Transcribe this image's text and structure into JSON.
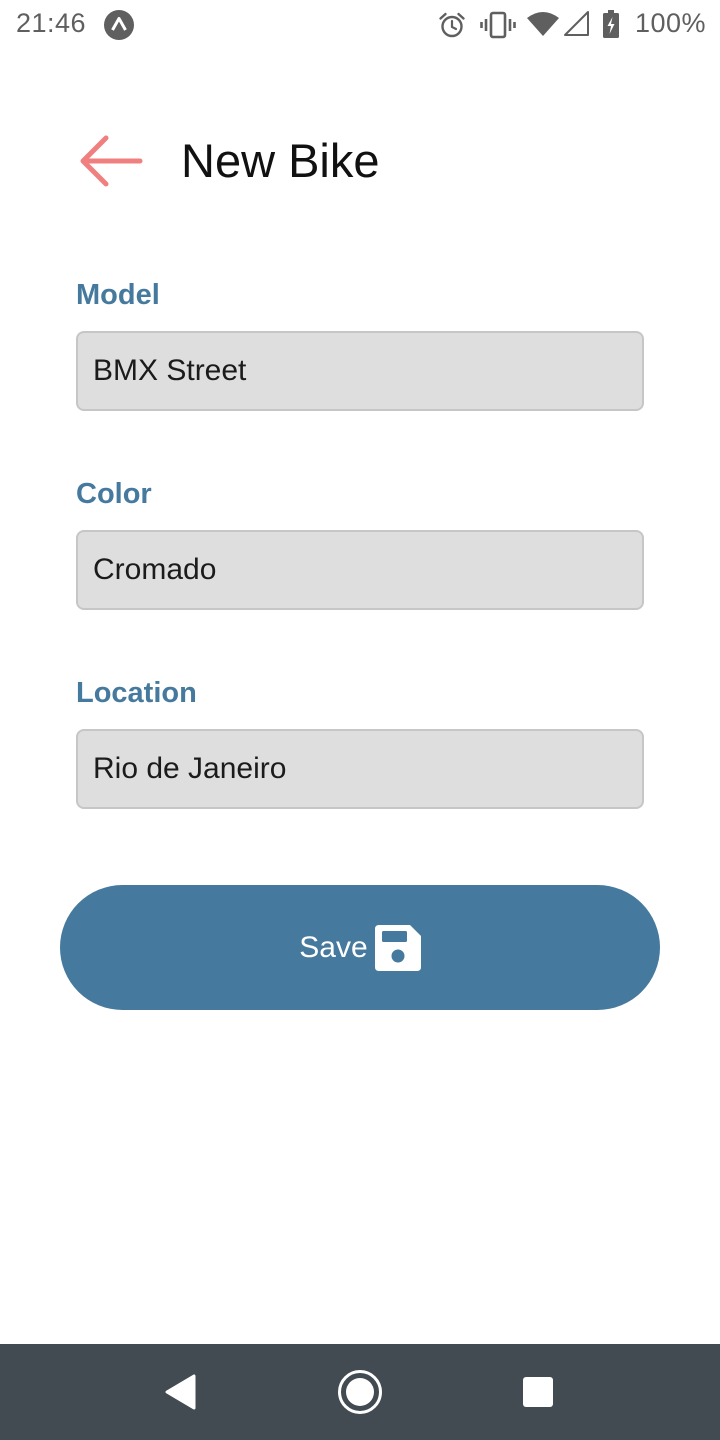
{
  "status_bar": {
    "time": "21:46",
    "battery": "100%",
    "icons": [
      "app-notification-icon",
      "alarm-icon",
      "vibrate-icon",
      "wifi-icon",
      "signal-icon",
      "battery-charging-icon"
    ]
  },
  "header": {
    "back_icon": "arrow-left-icon",
    "title": "New Bike"
  },
  "form": {
    "model": {
      "label": "Model",
      "value": "BMX Street"
    },
    "color": {
      "label": "Color",
      "value": "Cromado"
    },
    "location": {
      "label": "Location",
      "value": "Rio de Janeiro"
    }
  },
  "save_button": {
    "label": "Save",
    "icon": "floppy-disk-icon"
  },
  "nav_bar": {
    "icons": [
      "nav-back-icon",
      "nav-home-icon",
      "nav-recents-icon"
    ]
  },
  "colors": {
    "accent": "#45799d",
    "back_arrow": "#f07f7f",
    "input_bg": "#dedede",
    "nav_bar": "#434b52"
  }
}
